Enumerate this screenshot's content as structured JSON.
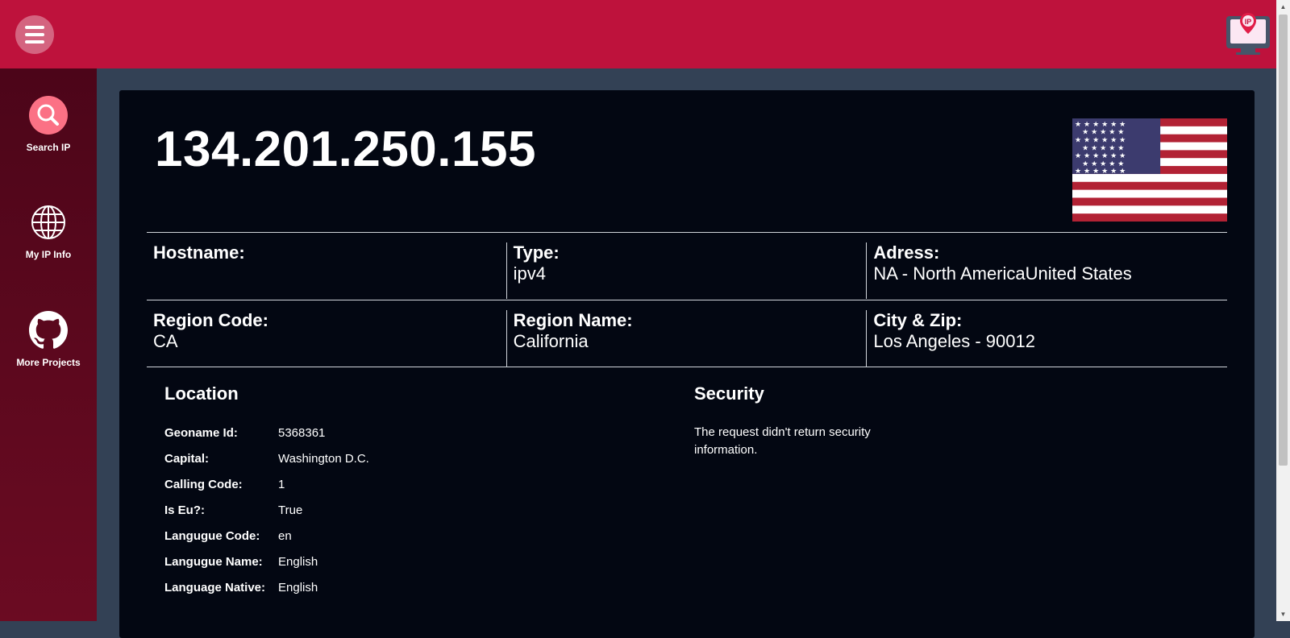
{
  "topbar": {
    "menu_icon": "hamburger-icon",
    "logo_label": "IP",
    "brand_color": "#be123c"
  },
  "sidebar": {
    "items": [
      {
        "label": "Search IP",
        "icon": "search-icon"
      },
      {
        "label": "My IP Info",
        "icon": "globe-icon"
      },
      {
        "label": "More Projects",
        "icon": "github-icon"
      }
    ]
  },
  "main": {
    "ip": "134.201.250.155",
    "flag_icon": "us-flag-icon",
    "fields": [
      {
        "label": "Hostname:",
        "value": ""
      },
      {
        "label": "Type:",
        "value": "ipv4"
      },
      {
        "label": "Adress:",
        "value": "NA - North AmericaUnited States"
      },
      {
        "label": "Region Code:",
        "value": "CA"
      },
      {
        "label": "Region Name:",
        "value": "California"
      },
      {
        "label": "City & Zip:",
        "value": "Los Angeles - 90012"
      }
    ],
    "location": {
      "title": "Location",
      "rows": [
        {
          "key": "Geoname Id:",
          "value": "5368361"
        },
        {
          "key": "Capital:",
          "value": "Washington D.C."
        },
        {
          "key": "Calling Code:",
          "value": "1"
        },
        {
          "key": "Is Eu?:",
          "value": "True"
        },
        {
          "key": "Langugue Code:",
          "value": "en"
        },
        {
          "key": "Langugue Name:",
          "value": "English"
        },
        {
          "key": "Language Native:",
          "value": "English"
        }
      ]
    },
    "security": {
      "title": "Security",
      "message": "The request didn't return security information."
    }
  }
}
